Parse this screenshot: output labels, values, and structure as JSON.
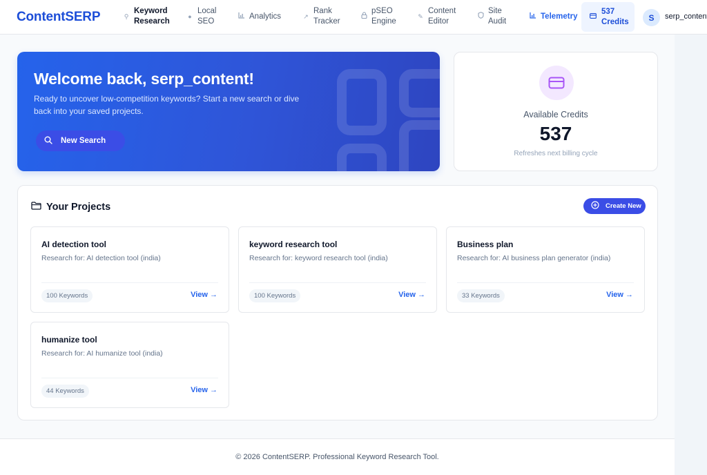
{
  "nav": {
    "logo": "ContentSERP",
    "items": [
      {
        "label_line1": "Keyword",
        "label_line2": "Research",
        "icon": "search-icon"
      },
      {
        "label_line1": "Local",
        "label_line2": "SEO",
        "icon": "pin-icon"
      },
      {
        "label_line1": "Analytics",
        "icon": "bar-chart-icon"
      },
      {
        "label_line1": "Rank",
        "label_line2": "Tracker",
        "icon": "trend-icon"
      },
      {
        "label_line1": "pSEO",
        "label_line2": "Engine",
        "icon": "lock-icon"
      },
      {
        "label_line1": "Content",
        "label_line2": "Editor",
        "icon": "pencil-icon"
      },
      {
        "label_line1": "Site",
        "label_line2": "Audit",
        "icon": "shield-icon"
      },
      {
        "label_line1": "Telemetry",
        "icon": "bar-chart-icon"
      }
    ],
    "credits_line1": "537",
    "credits_line2": "Credits",
    "avatar_initial": "S",
    "username": "serp_content"
  },
  "hero": {
    "title": "Welcome back, serp_content!",
    "subtitle": "Ready to uncover low-competition keywords? Start a new search or dive back into your saved projects.",
    "button": "New Search"
  },
  "credits_card": {
    "label": "Available Credits",
    "value": "537",
    "note": "Refreshes next billing cycle"
  },
  "projects": {
    "title": "Your Projects",
    "create_button": "Create New",
    "items": [
      {
        "name": "AI detection tool",
        "research": "Research for: AI detection tool (india)",
        "keywords": "100 Keywords",
        "view": "View →"
      },
      {
        "name": "keyword research tool",
        "research": "Research for: keyword research tool (india)",
        "keywords": "100 Keywords",
        "view": "View →"
      },
      {
        "name": "Business plan",
        "research": "Research for: AI business plan generator (india)",
        "keywords": "33 Keywords",
        "view": "View →"
      },
      {
        "name": "humanize tool",
        "research": "Research for: AI humanize tool (india)",
        "keywords": "44 Keywords",
        "view": "View →"
      }
    ]
  },
  "footer": {
    "text": "© 2026 ContentSERP. Professional Keyword Research Tool."
  },
  "colors": {
    "brand": "#1d4ed8",
    "accent": "#3b4de6",
    "credits_icon": "#a855f7"
  }
}
